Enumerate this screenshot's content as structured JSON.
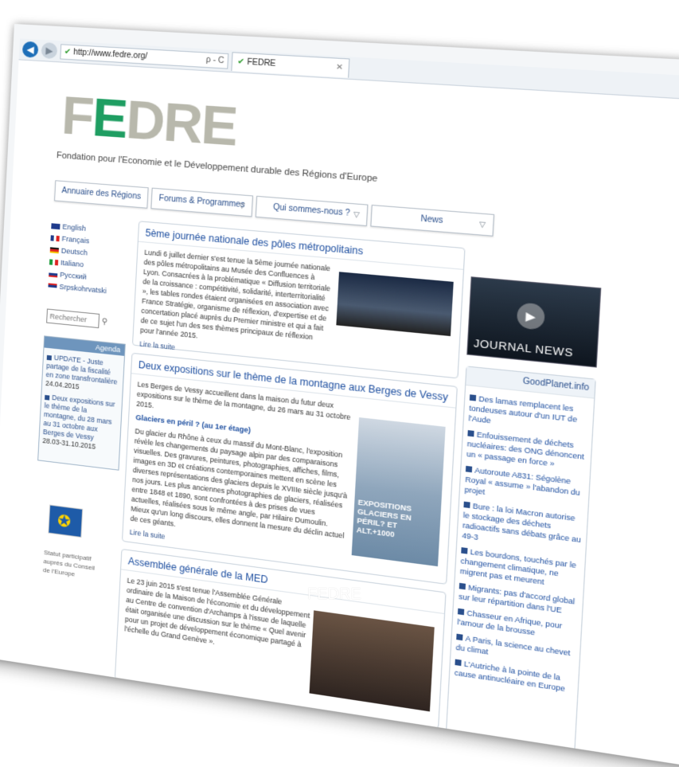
{
  "browser": {
    "url": "http://www.fedre.org/",
    "tab_title": "FEDRE",
    "address_tools": "ρ - C"
  },
  "site": {
    "logo": "FEDRE",
    "subtitle": "Fondation pour l'Economie et le Développement durable des Régions d'Europe"
  },
  "menu": [
    {
      "label": "Annuaire des Régions"
    },
    {
      "label": "Forums & Programmes"
    },
    {
      "label": "Qui sommes-nous ?"
    },
    {
      "label": "News"
    }
  ],
  "languages": [
    "English",
    "Français",
    "Deutsch",
    "Italiano",
    "Русский",
    "Srpskohrvatski"
  ],
  "search_placeholder": "Rechercher",
  "agenda": {
    "title": "Agenda",
    "items": [
      {
        "text": "UPDATE - Juste partage de la fiscalité en zone transfrontalière",
        "date": "24.04.2015"
      },
      {
        "text": "Deux expositions sur le thème de la montagne, du 28 mars au 31 octobre aux Berges de Vessy",
        "date": "28.03-31.10.2015"
      }
    ]
  },
  "council": {
    "caption": "Statut participatif auprès du Conseil de l'Europe"
  },
  "articles": [
    {
      "title": "5ème journée nationale des pôles métropolitains",
      "body": "Lundi 6 juillet dernier s'est tenue la 5ème journée nationale des pôles métropolitains au Musée des Confluences à Lyon. Consacrées à la problématique « Diffusion territoriale de la croissance : compétitivité, solidarité, interterritorialité », les tables rondes étaient organisées en association avec France Stratégie, organisme de réflexion, d'expertise et de concertation placé auprès du Premier ministre et qui a fait de ce sujet l'un des ses thèmes principaux de réflexion pour l'année 2015.",
      "more": "Lire la suite"
    },
    {
      "title": "Deux expositions sur le thème de la montagne aux Berges de Vessy",
      "body": "Les Berges de Vessy accueillent dans la maison du futur deux expositions sur le thème de la montagne, du 26 mars au 31 octobre 2015.",
      "kicker": "Glaciers en péril ? (au 1er étage)",
      "body2": "Du glacier du Rhône à ceux du massif du Mont-Blanc, l'exposition révèle les changements du paysage alpin par des comparaisons visuelles. Des gravures, peintures, photographies, affiches, films, images en 3D et créations contemporaines mettent en scène les diverses représentations des glaciers depuis le XVIIIe siècle jusqu'à nos jours. Les plus anciennes photographies de glaciers, réalisées entre 1848 et 1890, sont confrontées à des prises de vues actuelles, réalisées sous le même angle, par Hilaire Dumoulin. Mieux qu'un long discours, elles donnent la mesure du déclin actuel de ces géants.",
      "poster": "EXPOSITIONS GLACIERS EN PÉRIL? ET ALT.+1000",
      "more": "Lire la suite"
    },
    {
      "title": "Assemblée générale de la MED",
      "body": "Le 23 juin 2015 s'est tenue l'Assemblée Générale ordinaire de la Maison de l'économie et du développement au Centre de convention d'Archamps à l'issue de laquelle était organisée une discussion sur le thème « Quel avenir pour un projet de développement économique partagé à l'échelle du Grand Genève »."
    }
  ],
  "video": {
    "label": "JOURNAL NEWS"
  },
  "goodplanet": {
    "title": "GoodPlanet.info",
    "items": [
      "Des lamas remplacent les tondeuses autour d'un IUT de l'Aude",
      "Enfouissement de déchets nucléaires: des ONG dénoncent un « passage en force »",
      "Autoroute A831: Ségolène Royal « assume » l'abandon du projet",
      "Bure : la loi Macron autorise le stockage des déchets radioactifs sans débats grâce au 49-3",
      "Les bourdons, touchés par le changement climatique, ne migrent pas et meurent",
      "Migrants: pas d'accord global sur leur répartition dans l'UE",
      "Chasseur en Afrique, pour l'amour de la brousse",
      "A Paris, la science au chevet du climat",
      "L'Autriche à la pointe de la cause antinucléaire en Europe"
    ]
  },
  "watermark": "FEDRE",
  "colors": {
    "brand_green": "#1f9e62",
    "logo_grey": "#b8b8ac",
    "link_blue": "#1e4fa0"
  }
}
